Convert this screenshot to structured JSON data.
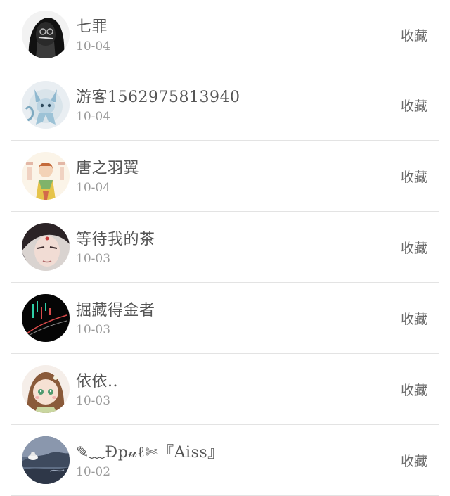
{
  "list": {
    "items": [
      {
        "name": "七罪",
        "date": "10-04",
        "action": "收藏",
        "avatar": "dark-portrait-avatar"
      },
      {
        "name": "游客1562975813940",
        "date": "10-04",
        "action": "收藏",
        "avatar": "blue-creature-avatar"
      },
      {
        "name": "唐之羽翼",
        "date": "10-04",
        "action": "收藏",
        "avatar": "anime-girl-avatar"
      },
      {
        "name": "等待我的茶",
        "date": "10-03",
        "action": "收藏",
        "avatar": "anime-man-avatar"
      },
      {
        "name": "掘藏得金者",
        "date": "10-03",
        "action": "收藏",
        "avatar": "stock-chart-avatar"
      },
      {
        "name": "依依..",
        "date": "10-03",
        "action": "收藏",
        "avatar": "chibi-girl-avatar"
      },
      {
        "name": "✎﹏Ɖp𝓊ℓ✄『Aiss』",
        "date": "10-02",
        "action": "收藏",
        "avatar": "landscape-avatar"
      }
    ]
  },
  "colors": {
    "name_text": "#555555",
    "date_text": "#9a9a9a",
    "action_text": "#6a6a6a",
    "divider": "#e3e3e3"
  }
}
